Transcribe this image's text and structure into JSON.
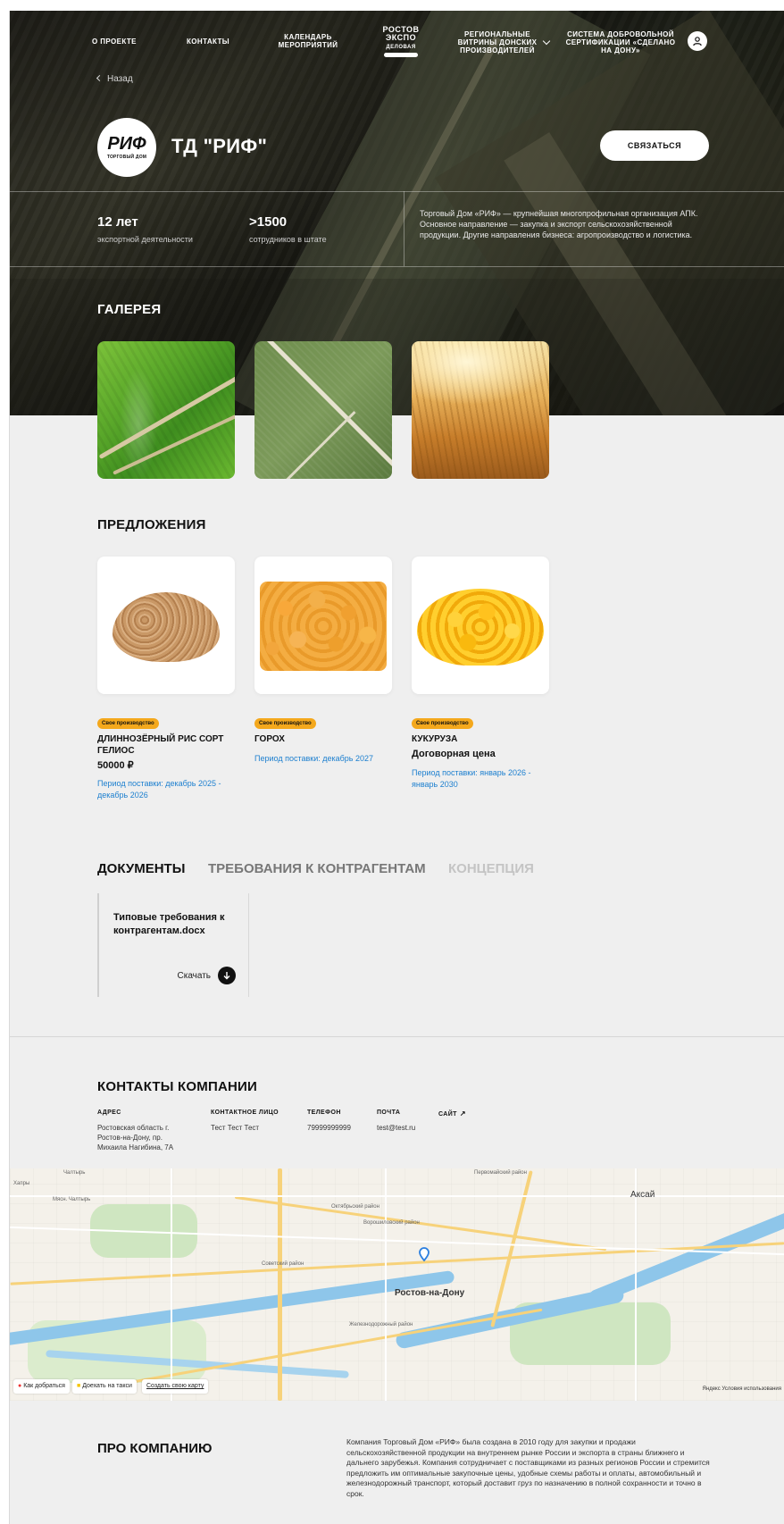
{
  "nav": {
    "items": [
      "О проекте",
      "Контакты",
      "Календарь мероприятий",
      "Региональные витрины донских производителей",
      "Система добровольной сертификации «Сделано на Дону»"
    ],
    "logo_line1": "РОСТОВ",
    "logo_line2": "ЭКСПО",
    "logo_line3": "ДЕЛОВАЯ"
  },
  "back_label": "Назад",
  "company": {
    "logo_text": "РИФ",
    "logo_sub": "ТОРГОВЫЙ ДОМ",
    "name": "ТД \"РИФ\"",
    "contact_button": "Связаться"
  },
  "stats": [
    {
      "value": "12 лет",
      "label": "экспортной деятельности"
    },
    {
      "value": ">1500",
      "label": "сотрудников в штате"
    }
  ],
  "short_about": "Торговый Дом «РИФ» — крупнейшая многопрофильная организация АПК. Основное направление — закупка и экспорт сельскохозяйственной продукции. Другие направления бизнеса: агропроизводство и логистика.",
  "gallery": {
    "title": "Галерея"
  },
  "offers": {
    "title": "Предложения",
    "items": [
      {
        "badge": "Свое производство",
        "name": "ДЛИННОЗЁРНЫЙ РИС СОРТ ГЕЛИОС",
        "price": "50000 ₽",
        "period": "Период поставки: декабрь 2025 - декабрь 2026"
      },
      {
        "badge": "Свое производство",
        "name": "ГОРОХ",
        "price": "",
        "period": "Период поставки: декабрь 2027"
      },
      {
        "badge": "Свое производство",
        "name": "КУКУРУЗА",
        "price": "Договорная цена",
        "period": "Период поставки: январь 2026 - январь 2030"
      }
    ]
  },
  "documents": {
    "tabs": [
      "ДОКУМЕНТЫ",
      "ТРЕБОВАНИЯ К КОНТРАГЕНТАМ",
      "КОНЦЕПЦИЯ"
    ],
    "file_name": "Типовые требования к контрагентам.docx",
    "download_label": "Скачать"
  },
  "contacts": {
    "title": "Контакты компании",
    "address_head": "Адрес",
    "address": "Ростовская область г. Ростов-на-Дону, пр. Михаила Нагибина, 7А",
    "person_head": "Контактное лицо",
    "person": "Тест Тест Тест",
    "phone_head": "Телефон",
    "phone": "79999999999",
    "email_head": "Почта",
    "email": "test@test.ru",
    "site_head": "Сайт"
  },
  "map": {
    "city": "Ростов-на-Дону",
    "aksay": "Аксай",
    "route_btn": "Как добраться",
    "taxi_btn": "Доехать на такси",
    "create_map": "Создать свою карту",
    "terms": "Яндекс Условия использования",
    "labels": [
      "Чалтырь",
      "Мясн. Чалтырь",
      "Хапры",
      "Октябрьский район",
      "Советский район",
      "Железнодорожный район",
      "Ворошиловский район",
      "Первомайский район"
    ]
  },
  "about": {
    "title": "Про компанию",
    "text": "Компания Торговый Дом «РИФ» была создана в 2010 году для закупки и продажи сельскохозяйственной продукции на внутреннем рынке России и экспорта в страны ближнего и дальнего зарубежья. Компания сотрудничает с поставщиками из разных регионов России и стремится предложить им оптимальные закупочные цены, удобные схемы работы и оплаты, автомобильный и железнодорожный транспорт, который доставит груз по назначению в полной сохранности и точно в срок."
  }
}
